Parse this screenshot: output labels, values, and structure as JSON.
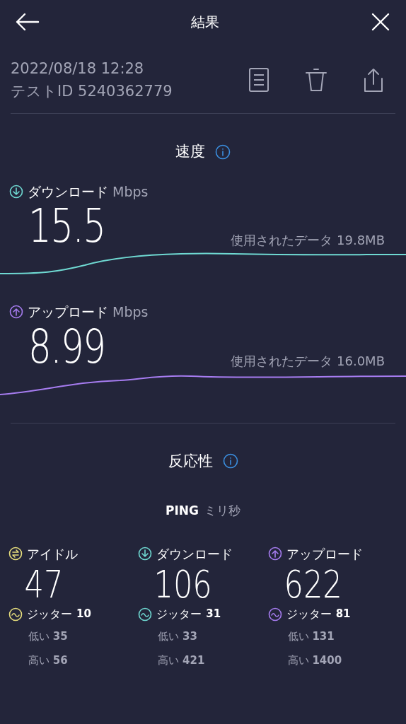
{
  "header": {
    "title": "結果"
  },
  "test": {
    "datetime": "2022/08/18 12:28",
    "id": "テストID 5240362779"
  },
  "speed": {
    "title": "速度",
    "items": [
      {
        "kind": "download",
        "color": "#6fd9d2",
        "label": "ダウンロード",
        "unit": "Mbps",
        "value": "15.5",
        "data_used": "使用されたデータ 19.8MB"
      },
      {
        "kind": "upload",
        "color": "#a67cf0",
        "label": "アップロード",
        "unit": "Mbps",
        "value": "8.99",
        "data_used": "使用されたデータ 16.0MB"
      }
    ]
  },
  "responsiveness": {
    "title": "反応性",
    "ping_label": "PING",
    "ping_unit": "ミリ秒",
    "columns": [
      {
        "kind": "idle",
        "color": "#e6dd7c",
        "label": "アイドル",
        "value": "47",
        "jitter_label": "ジッター",
        "jitter": "10",
        "low": "低い **35**",
        "high": "高い **56**"
      },
      {
        "kind": "download",
        "color": "#6fd9d2",
        "label": "ダウンロード",
        "value": "106",
        "jitter_label": "ジッター",
        "jitter": "31",
        "low": "低い **33**",
        "high": "高い **421**"
      },
      {
        "kind": "upload",
        "color": "#a67cf0",
        "label": "アップロード",
        "value": "622",
        "jitter_label": "ジッター",
        "jitter": "81",
        "low": "低い **131**",
        "high": "高い **1400**"
      }
    ]
  }
}
